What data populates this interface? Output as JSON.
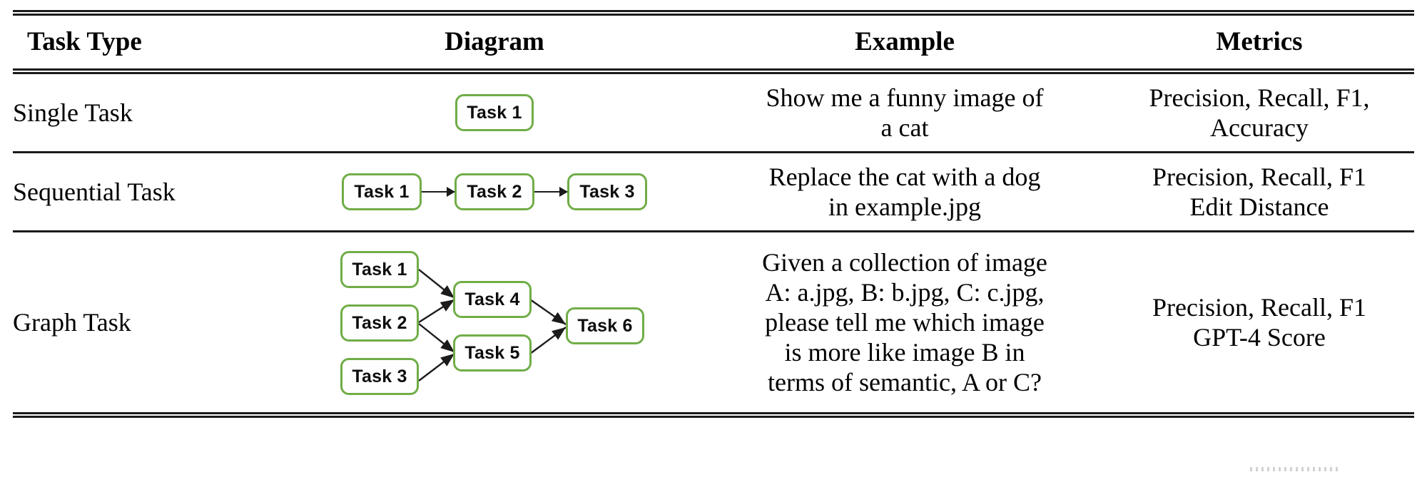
{
  "table": {
    "columns": [
      {
        "id": "task_type",
        "label": "Task Type",
        "align": "left"
      },
      {
        "id": "diagram",
        "label": "Diagram",
        "align": "center"
      },
      {
        "id": "example",
        "label": "Example",
        "align": "center"
      },
      {
        "id": "metrics",
        "label": "Metrics",
        "align": "center"
      }
    ],
    "rows": [
      {
        "task_type": "Single Task",
        "diagram_kind": "single",
        "example_lines": [
          "Show me a funny image of",
          "a cat"
        ],
        "metrics_lines": [
          "Precision, Recall, F1,",
          "Accuracy"
        ]
      },
      {
        "task_type": "Sequential Task",
        "diagram_kind": "sequential",
        "example_lines": [
          "Replace the cat with a dog",
          "in example.jpg"
        ],
        "metrics_lines": [
          "Precision, Recall, F1",
          "Edit Distance"
        ]
      },
      {
        "task_type": "Graph Task",
        "diagram_kind": "graph",
        "example_lines": [
          "Given a collection of image",
          "A: a.jpg, B: b.jpg, C: c.jpg,",
          "please tell me which image",
          "is more like image B in",
          "terms of semantic, A or C?"
        ],
        "metrics_lines": [
          "Precision, Recall, F1",
          "GPT-4 Score"
        ]
      }
    ]
  },
  "diagrams": {
    "single": {
      "nodes": [
        {
          "id": "t1",
          "label": "Task 1"
        }
      ],
      "edges": []
    },
    "sequential": {
      "nodes": [
        {
          "id": "t1",
          "label": "Task 1"
        },
        {
          "id": "t2",
          "label": "Task 2"
        },
        {
          "id": "t3",
          "label": "Task 3"
        }
      ],
      "edges": [
        {
          "from": "t1",
          "to": "t2"
        },
        {
          "from": "t2",
          "to": "t3"
        }
      ]
    },
    "graph": {
      "nodes": [
        {
          "id": "g1",
          "label": "Task 1"
        },
        {
          "id": "g2",
          "label": "Task 2"
        },
        {
          "id": "g3",
          "label": "Task 3"
        },
        {
          "id": "g4",
          "label": "Task 4"
        },
        {
          "id": "g5",
          "label": "Task 5"
        },
        {
          "id": "g6",
          "label": "Task 6"
        }
      ],
      "edges": [
        {
          "from": "g1",
          "to": "g4"
        },
        {
          "from": "g2",
          "to": "g4"
        },
        {
          "from": "g2",
          "to": "g5"
        },
        {
          "from": "g3",
          "to": "g5"
        },
        {
          "from": "g4",
          "to": "g6"
        },
        {
          "from": "g5",
          "to": "g6"
        }
      ]
    }
  },
  "colors": {
    "node_border": "#70ad47",
    "node_fill": "#fefefe",
    "rule": "#1b1b1b",
    "text": "#000000",
    "arrow": "#1b1b1b"
  }
}
